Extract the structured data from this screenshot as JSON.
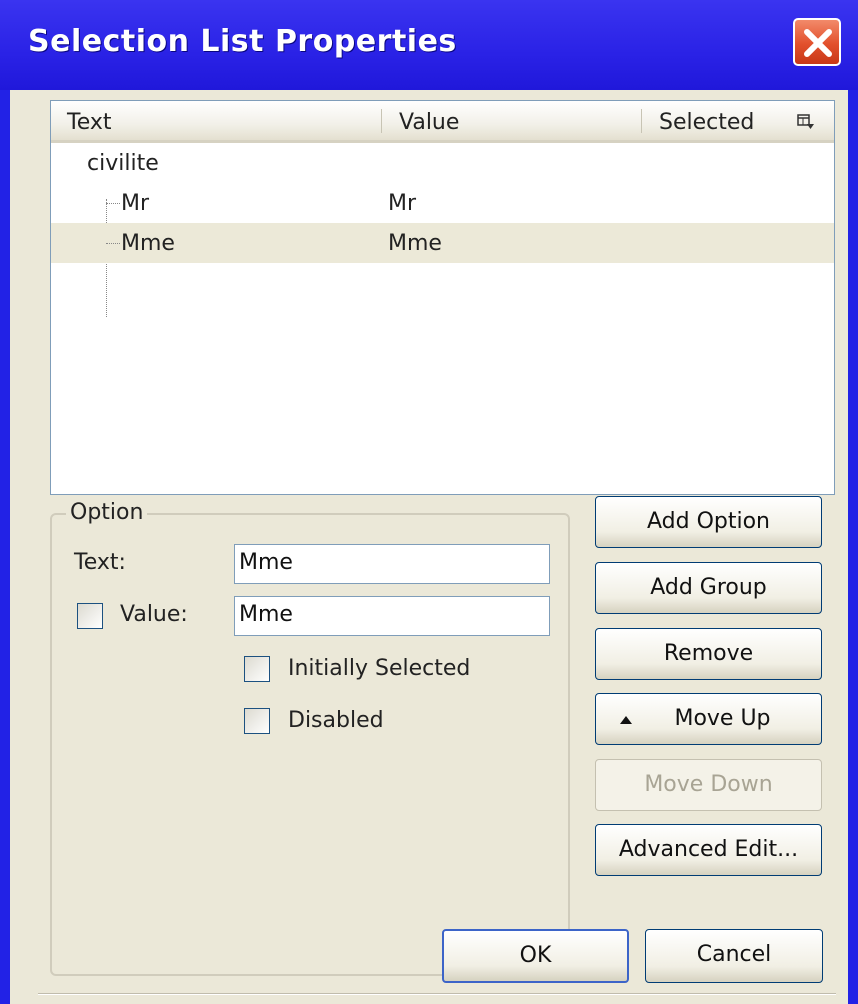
{
  "window": {
    "title": "Selection List Properties"
  },
  "list": {
    "columns": [
      "Text",
      "Value",
      "Selected"
    ],
    "group_label": "civilite",
    "rows": [
      {
        "text": "Mr",
        "value": "Mr"
      },
      {
        "text": "Mme",
        "value": "Mme"
      }
    ]
  },
  "option": {
    "group_title": "Option",
    "text_label": "Text:",
    "text_value": "Mme",
    "value_label": "Value:",
    "value_value": "Mme",
    "initially_selected_label": "Initially Selected",
    "disabled_label": "Disabled"
  },
  "buttons": {
    "add_option": "Add Option",
    "add_group": "Add Group",
    "remove": "Remove",
    "move_up": "Move Up",
    "move_down": "Move Down",
    "advanced_edit": "Advanced Edit...",
    "ok": "OK",
    "cancel": "Cancel"
  }
}
